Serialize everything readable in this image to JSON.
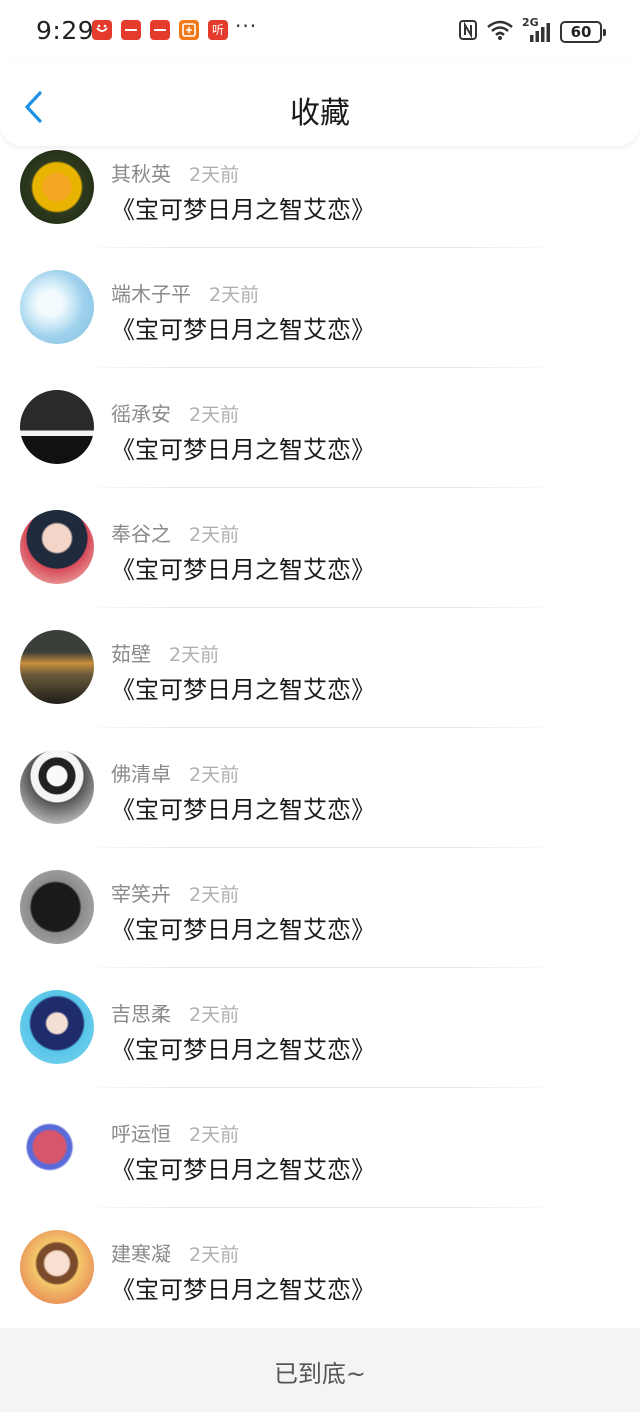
{
  "status_bar": {
    "time": "9:29",
    "app_icons": [
      "huawei-app-icon",
      "huawei-app-icon",
      "huawei-app-icon",
      "taobao-app-icon",
      "listen-app-icon"
    ],
    "listen_label": "听",
    "more": "···",
    "signal_label": "2G",
    "battery": "60"
  },
  "header": {
    "title": "收藏"
  },
  "items": [
    {
      "name": "其秋英",
      "time": "2天前",
      "content": "《宝可梦日月之智艾恋》"
    },
    {
      "name": "端木子平",
      "time": "2天前",
      "content": "《宝可梦日月之智艾恋》"
    },
    {
      "name": "徭承安",
      "time": "2天前",
      "content": "《宝可梦日月之智艾恋》"
    },
    {
      "name": "奉谷之",
      "time": "2天前",
      "content": "《宝可梦日月之智艾恋》"
    },
    {
      "name": "茹壁",
      "time": "2天前",
      "content": "《宝可梦日月之智艾恋》"
    },
    {
      "name": "佛清卓",
      "time": "2天前",
      "content": "《宝可梦日月之智艾恋》"
    },
    {
      "name": "宰笑卉",
      "time": "2天前",
      "content": "《宝可梦日月之智艾恋》"
    },
    {
      "name": "吉思柔",
      "time": "2天前",
      "content": "《宝可梦日月之智艾恋》"
    },
    {
      "name": "呼运恒",
      "time": "2天前",
      "content": "《宝可梦日月之智艾恋》"
    },
    {
      "name": "建寒凝",
      "time": "2天前",
      "content": "《宝可梦日月之智艾恋》"
    }
  ],
  "footer": {
    "text": "已到底~"
  },
  "colors": {
    "accent": "#1e90e6",
    "muted_text": "#8a8a8a"
  }
}
